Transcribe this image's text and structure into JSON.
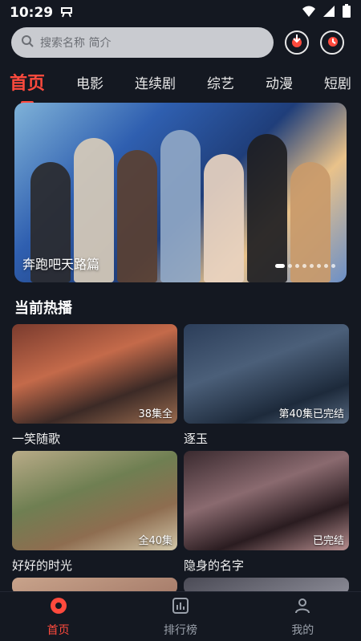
{
  "status": {
    "time": "10:29"
  },
  "search": {
    "placeholder": "搜索名称 简介"
  },
  "tabs": [
    {
      "label": "首页"
    },
    {
      "label": "电影"
    },
    {
      "label": "连续剧"
    },
    {
      "label": "综艺"
    },
    {
      "label": "动漫"
    },
    {
      "label": "短剧"
    }
  ],
  "banner": {
    "caption": "奔跑吧天路篇"
  },
  "section": {
    "title": "当前热播"
  },
  "cards": [
    {
      "name": "一笑随歌",
      "badge": "38集全"
    },
    {
      "name": "逐玉",
      "badge": "第40集已完结"
    },
    {
      "name": "好好的时光",
      "badge": "全40集"
    },
    {
      "name": "隐身的名字",
      "badge": "已完结"
    }
  ],
  "nav": [
    {
      "label": "首页"
    },
    {
      "label": "排行榜"
    },
    {
      "label": "我的"
    }
  ],
  "colors": {
    "accent": "#ff4a3d",
    "background": "#141821"
  }
}
